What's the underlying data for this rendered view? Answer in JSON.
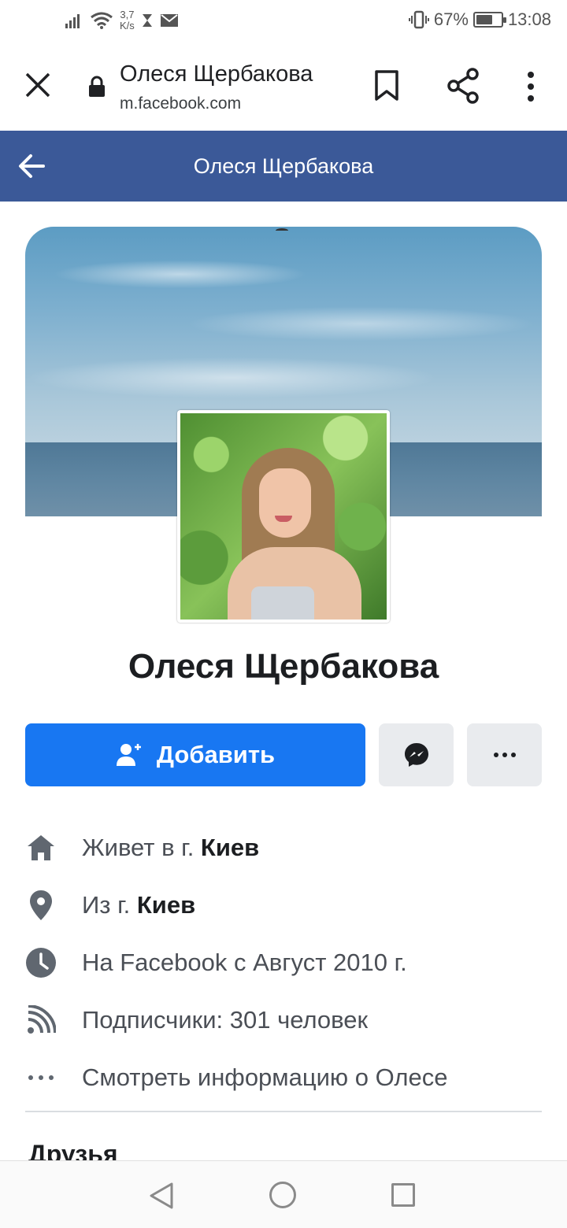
{
  "status_bar": {
    "net_speed_value": "3,7",
    "net_speed_unit": "K/s",
    "battery_percent": "67%",
    "battery_level": 0.67,
    "time": "13:08"
  },
  "browser": {
    "page_title": "Олеся Щербакова",
    "url": "m.facebook.com"
  },
  "fb_header": {
    "title": "Олеся Щербакова"
  },
  "profile": {
    "name": "Олеся Щербакова",
    "add_button_label": "Добавить"
  },
  "info": {
    "lives_prefix": "Живет в г. ",
    "lives_city": "Киев",
    "from_prefix": "Из г. ",
    "from_city": "Киев",
    "joined": "На Facebook с Август 2010 г.",
    "followers": "Подписчики: 301 человек",
    "see_more": "Смотреть информацию о Олесе"
  },
  "sections": {
    "friends_title": "Друзья"
  },
  "colors": {
    "fb_header": "#3b5998",
    "primary_button": "#1877f2"
  }
}
